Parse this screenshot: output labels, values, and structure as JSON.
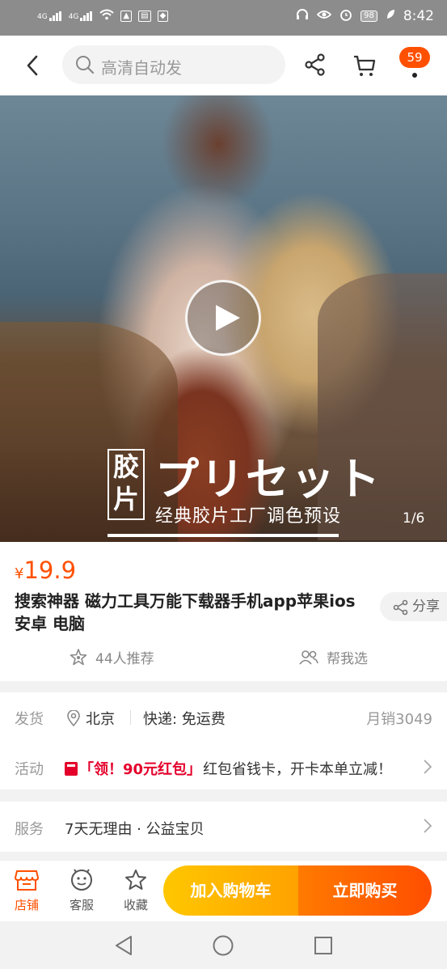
{
  "status_bar": {
    "left_signal_1": "4G",
    "left_signal_2": "4G",
    "battery": "98",
    "time": "8:42"
  },
  "top_nav": {
    "search_placeholder": "高清自动发",
    "message_count": "59"
  },
  "hero": {
    "brand_vertical_top": "胶",
    "brand_vertical_bottom": "片",
    "brand_title": "プリセット",
    "brand_subtitle": "经典胶片工厂调色预设",
    "page_indicator": "1/6"
  },
  "product": {
    "currency": "¥",
    "price": "19.9",
    "title": "搜索神器 磁力工具万能下载器手机app苹果ios 安卓 电脑",
    "share_label": "分享",
    "recommend_label": "44人推荐",
    "help_pick_label": "帮我选"
  },
  "shipping": {
    "label": "发货",
    "location": "北京",
    "fee": "快递: 免运费",
    "monthly_sales": "月销3049"
  },
  "activity": {
    "label": "活动",
    "tag": "「领！90元红包」",
    "text": "红包省钱卡，开卡本单立减！"
  },
  "service": {
    "label": "服务",
    "value": "7天无理由 · 公益宝贝"
  },
  "bottom_bar": {
    "store_label": "店铺",
    "service_label": "客服",
    "favorite_label": "收藏",
    "add_to_cart": "加入购物车",
    "buy_now": "立即购买"
  },
  "colors": {
    "accent": "#ff5000",
    "promo_red": "#e4002b",
    "cart_button": "#ffb300",
    "buy_button": "#ff5a00"
  }
}
